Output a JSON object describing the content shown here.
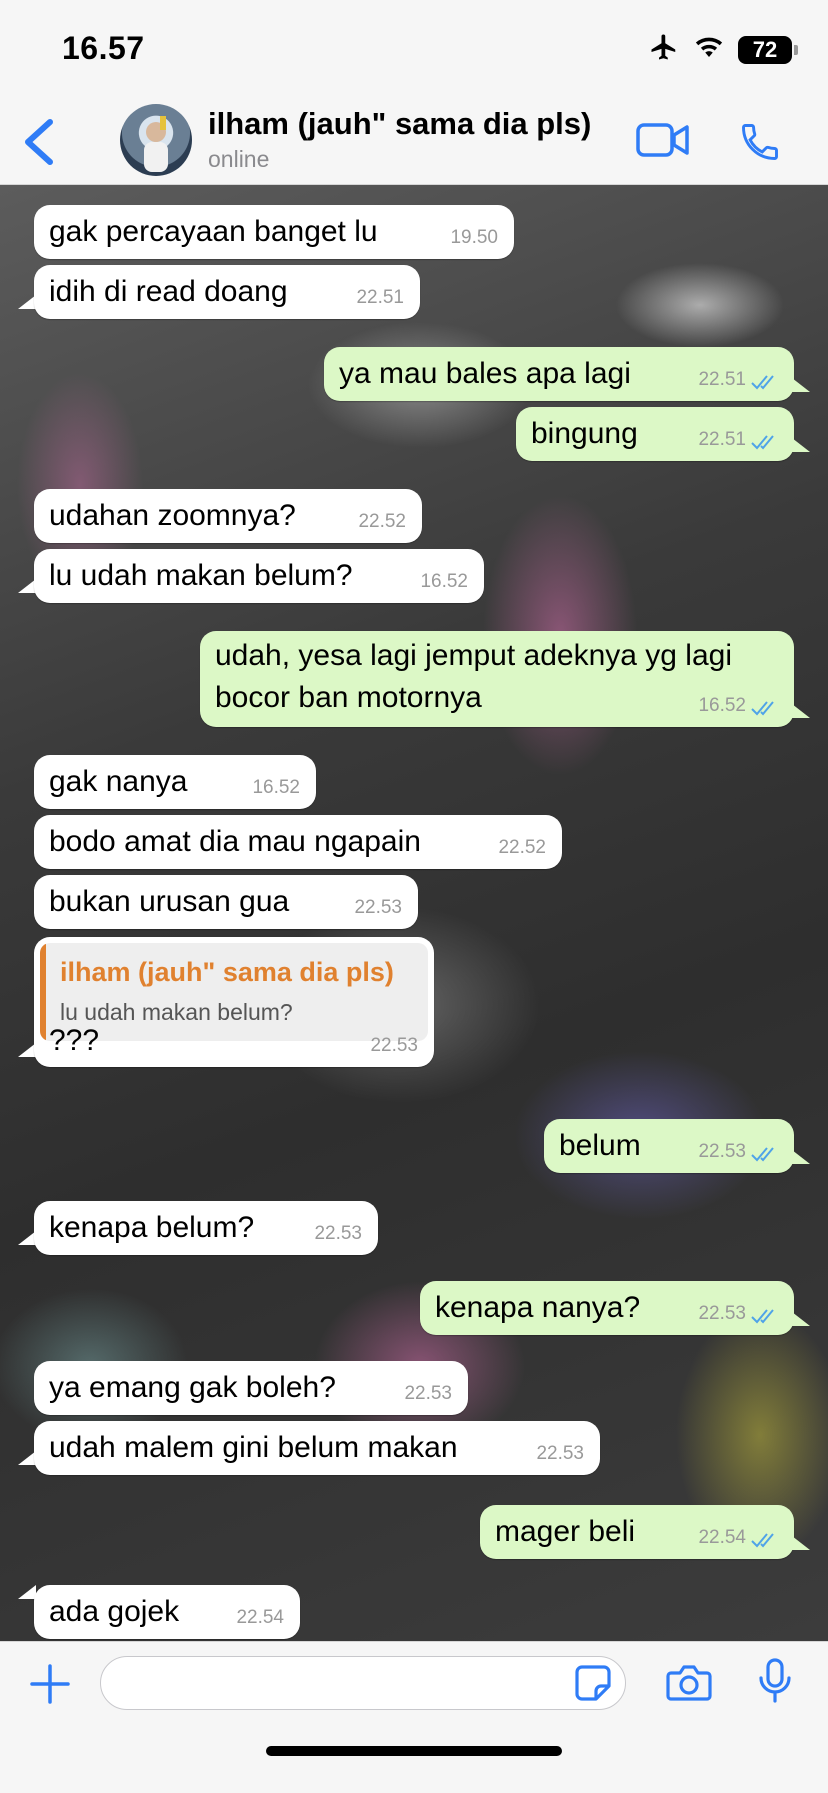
{
  "status_bar": {
    "time": "16.57",
    "battery": "72"
  },
  "header": {
    "contact_name": "ilham (jauh\" sama dia pls)",
    "contact_status": "online"
  },
  "messages": [
    {
      "dir": "in",
      "text": "gak percayaan banget lu",
      "time": "19.50"
    },
    {
      "dir": "in",
      "text": "idih di read doang",
      "time": "22.51"
    },
    {
      "dir": "out",
      "text": "ya mau bales apa lagi",
      "time": "22.51"
    },
    {
      "dir": "out",
      "text": "bingung",
      "time": "22.51"
    },
    {
      "dir": "in",
      "text": "udahan zoomnya?",
      "time": "22.52"
    },
    {
      "dir": "in",
      "text": "lu udah makan belum?",
      "time": "16.52"
    },
    {
      "dir": "out",
      "text": "udah, yesa lagi jemput adeknya yg lagi bocor ban motornya",
      "time": "16.52"
    },
    {
      "dir": "in",
      "text": "gak nanya",
      "time": "16.52"
    },
    {
      "dir": "in",
      "text": "bodo amat dia mau ngapain",
      "time": "22.52"
    },
    {
      "dir": "in",
      "text": "bukan urusan gua",
      "time": "22.53"
    },
    {
      "dir": "in",
      "text": "???",
      "time": "22.53",
      "quote_author": "ilham (jauh\" sama dia pls)",
      "quote_text": "lu udah makan belum?"
    },
    {
      "dir": "out",
      "text": "belum",
      "time": "22.53"
    },
    {
      "dir": "in",
      "text": "kenapa belum?",
      "time": "22.53"
    },
    {
      "dir": "out",
      "text": "kenapa nanya?",
      "time": "22.53"
    },
    {
      "dir": "in",
      "text": "ya emang gak boleh?",
      "time": "22.53"
    },
    {
      "dir": "in",
      "text": "udah malem gini belum makan",
      "time": "22.53"
    },
    {
      "dir": "out",
      "text": "mager beli",
      "time": "22.54"
    },
    {
      "dir": "in",
      "text": "ada gojek",
      "time": "22.54"
    }
  ],
  "input": {
    "placeholder": ""
  },
  "colors": {
    "accent": "#2f7cf6",
    "outgoing_bubble": "#dcf8c6",
    "incoming_bubble": "#ffffff",
    "quote_author": "#e0812f",
    "read_ticks": "#4fa3e8"
  }
}
